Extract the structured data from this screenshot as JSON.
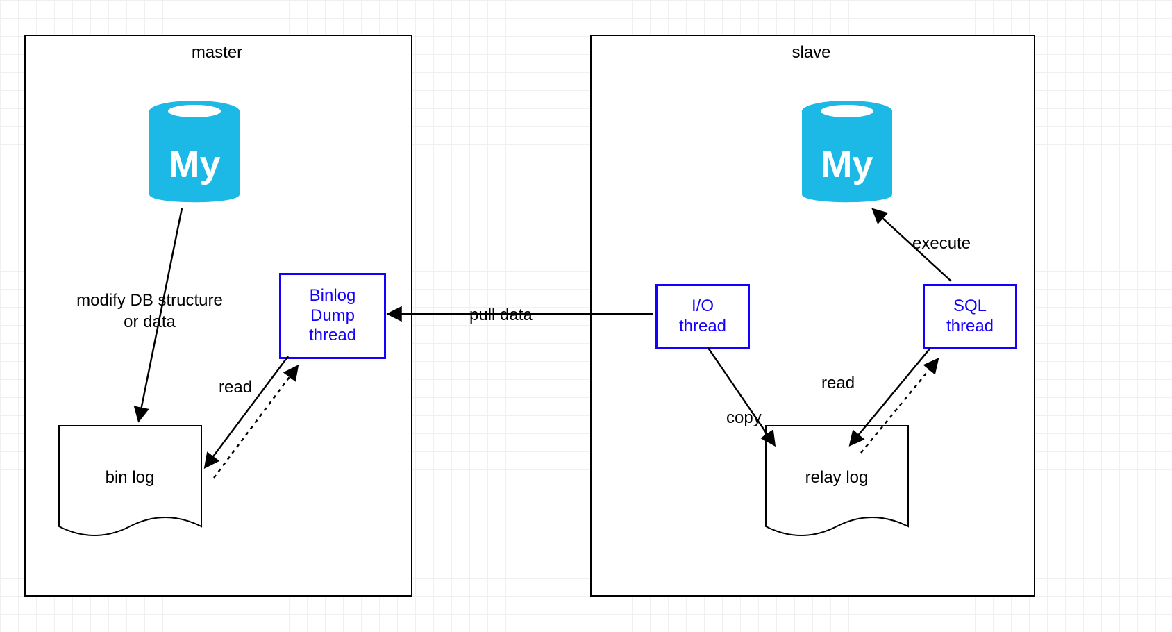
{
  "diagram": {
    "master": {
      "title": "master",
      "db_icon_label": "My",
      "binlog": "bin log",
      "binlog_dump_thread": "Binlog\nDump\nthread",
      "edge_modify": "modify DB structure\nor data",
      "edge_read": "read"
    },
    "slave": {
      "title": "slave",
      "db_icon_label": "My",
      "relaylog": "relay log",
      "io_thread": "I/O\nthread",
      "sql_thread": "SQL\nthread",
      "edge_execute": "execute",
      "edge_read": "read",
      "edge_copy": "copy"
    },
    "edge_pull": "pull data"
  },
  "colors": {
    "thread_border": "#1400ff",
    "thread_text": "#1400ff",
    "db_fill": "#1cb9e6",
    "black": "#000000"
  }
}
